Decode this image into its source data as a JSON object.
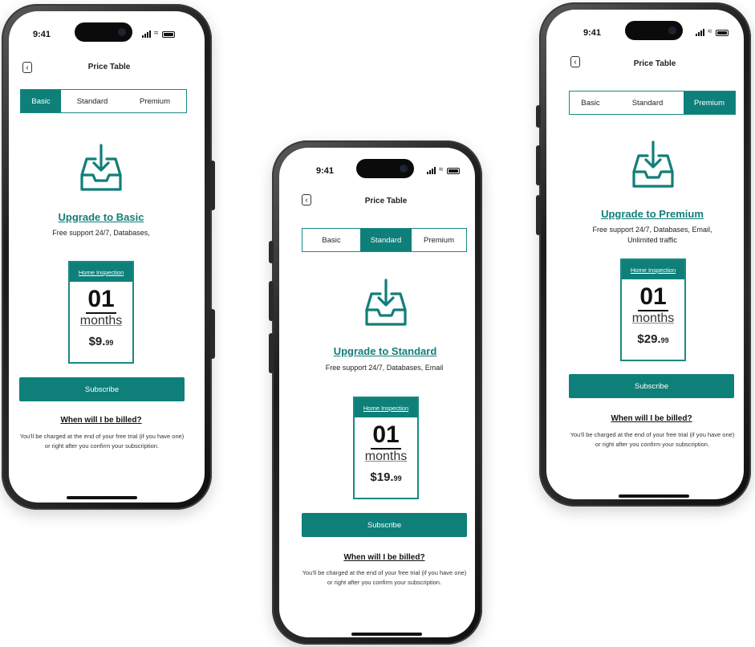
{
  "status": {
    "time": "9:41"
  },
  "header": {
    "title": "Price Table",
    "back_icon": "chevron-left-icon"
  },
  "tabs": [
    "Basic",
    "Standard",
    "Premium"
  ],
  "common": {
    "card_header": "Home Inspection",
    "card_number": "01",
    "card_unit": "months",
    "subscribe_label": "Subscribe",
    "billing_question": "When will I be billed?",
    "billing_answer": "You'll be charged at the end of your free trial (if you have one) or right after you confirm your subscription.",
    "icon": "inbox-download-icon"
  },
  "plans": [
    {
      "active_tab": "Basic",
      "upgrade_title": "Upgrade to Basic",
      "features": "Free support 24/7, Databases,",
      "price_main": "$9.",
      "price_cents": "99"
    },
    {
      "active_tab": "Standard",
      "upgrade_title": "Upgrade to Standard",
      "features": "Free support 24/7, Databases, Email",
      "price_main": "$19.",
      "price_cents": "99"
    },
    {
      "active_tab": "Premium",
      "upgrade_title": "Upgrade to Premium",
      "features": "Free support 24/7, Databases, Email, Unlimited traffic",
      "price_main": "$29.",
      "price_cents": "99"
    }
  ],
  "colors": {
    "accent": "#0f7f79",
    "phone_frame": "#1c1c1c"
  }
}
